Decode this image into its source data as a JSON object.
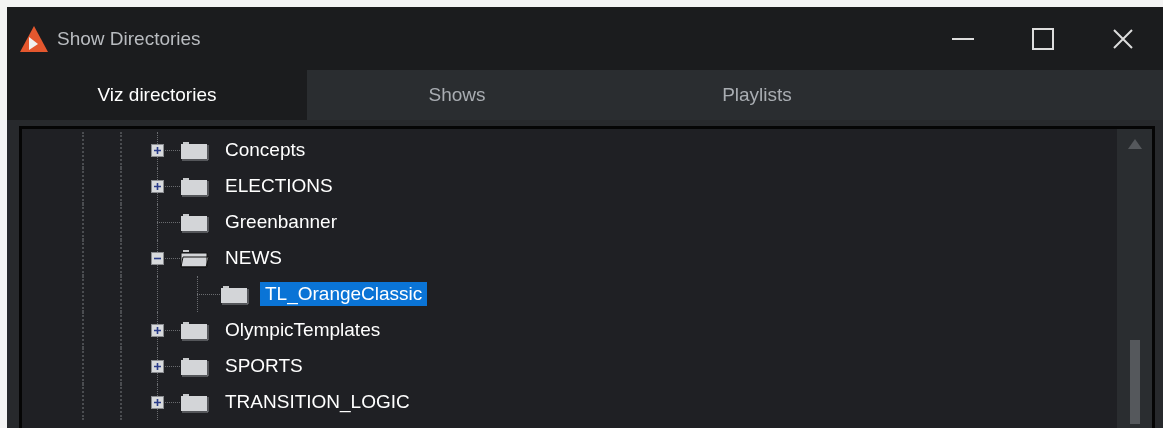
{
  "window": {
    "title": "Show Directories"
  },
  "tabs": [
    {
      "label": "Viz directories",
      "selected": true
    },
    {
      "label": "Shows",
      "selected": false
    },
    {
      "label": "Playlists",
      "selected": false
    }
  ],
  "tree": {
    "items": [
      {
        "label": "Concepts",
        "expandable": true,
        "expanded": false,
        "selected": false
      },
      {
        "label": "ELECTIONS",
        "expandable": true,
        "expanded": false,
        "selected": false
      },
      {
        "label": "Greenbanner",
        "expandable": false,
        "expanded": false,
        "selected": false
      },
      {
        "label": "NEWS",
        "expandable": true,
        "expanded": true,
        "selected": false,
        "children": [
          {
            "label": "TL_OrangeClassic",
            "expandable": false,
            "expanded": false,
            "selected": true
          }
        ]
      },
      {
        "label": "OlympicTemplates",
        "expandable": true,
        "expanded": false,
        "selected": false
      },
      {
        "label": "SPORTS",
        "expandable": true,
        "expanded": false,
        "selected": false
      },
      {
        "label": "TRANSITION_LOGIC",
        "expandable": true,
        "expanded": false,
        "selected": false
      }
    ]
  }
}
